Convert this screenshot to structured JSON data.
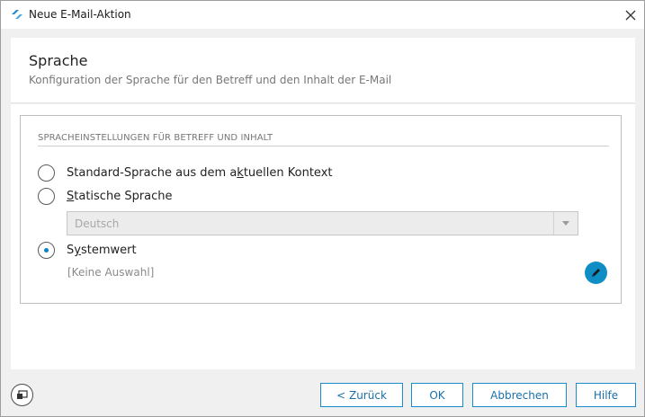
{
  "window": {
    "title": "Neue E-Mail-Aktion"
  },
  "header": {
    "title": "Sprache",
    "subtitle": "Konfiguration der Sprache für den Betreff und den Inhalt der E-Mail"
  },
  "group": {
    "title": "SPRACHEINSTELLUNGEN FÜR BETREFF UND INHALT",
    "options": [
      {
        "label_pre": "Standard-Sprache aus dem a",
        "mnemonic": "k",
        "label_post": "tuellen Kontext",
        "checked": false
      },
      {
        "label_pre": "",
        "mnemonic": "S",
        "label_post": "tatische Sprache",
        "checked": false
      },
      {
        "label_pre": "S",
        "mnemonic": "y",
        "label_post": "stemwert",
        "checked": true
      }
    ],
    "language_select": {
      "value": "Deutsch"
    },
    "system_value": "[Keine Auswahl]"
  },
  "buttons": {
    "back": "< Zurück",
    "ok": "OK",
    "cancel": "Abbrechen",
    "help": "Hilfe"
  },
  "colors": {
    "accent": "#0f8ec5",
    "button_border": "#1a8ccc"
  },
  "icons": {
    "app": "app-logo-icon",
    "close": "close-icon",
    "edit": "pencil-icon",
    "footer": "window-layout-icon"
  }
}
